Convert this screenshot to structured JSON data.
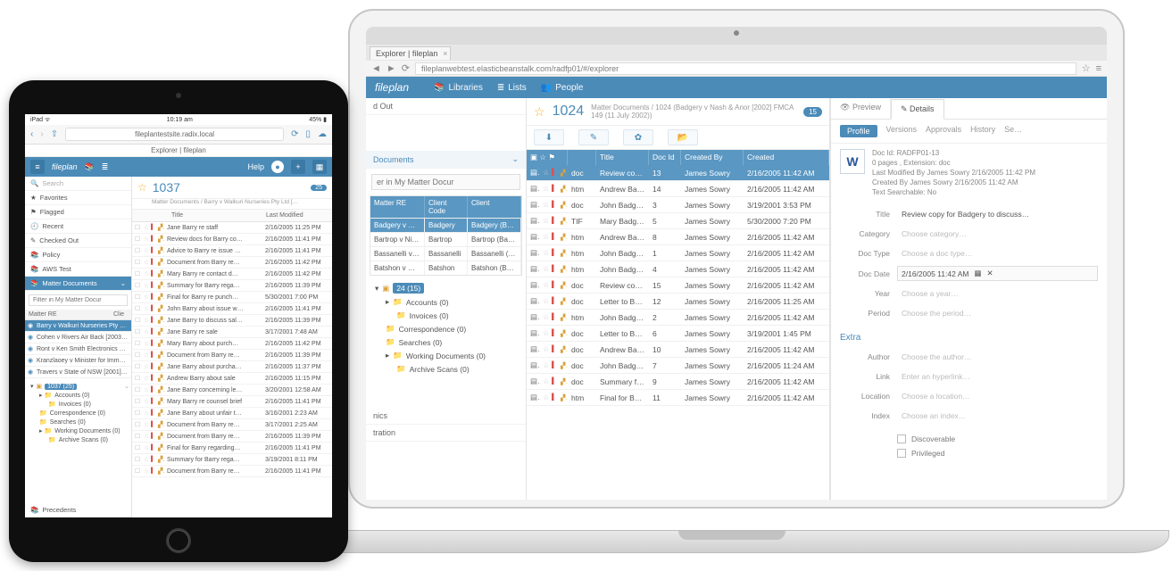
{
  "laptop": {
    "browser": {
      "tab_title": "Explorer | fileplan",
      "url": "fileplanwebtest.elasticbeanstalk.com/radfp01/#/explorer"
    },
    "appbar": {
      "brand": "fileplan",
      "items": [
        "Libraries",
        "Lists",
        "People"
      ]
    },
    "sidebar": {
      "checked_out": "d Out",
      "matter_docs": "Documents",
      "filter_ph": "er in My Matter Docur",
      "mini_head": [
        "Matter RE",
        "Client Code",
        "Client"
      ],
      "mini_rows": [
        [
          "Badgery v Nash & A…",
          "Badgery",
          "Badgery (Badgery…"
        ],
        [
          "Bartrop v Nilant & A…",
          "Bartrop",
          "Bartrop (Bartrop)"
        ],
        [
          "Bassanelli v QBE Ins…",
          "Bassanelli",
          "Bassanelli (Bassan…"
        ],
        [
          "Batshon v Miglioris…",
          "Batshon",
          "Batshon (Batshon…"
        ]
      ],
      "tree": {
        "root": "24 (15)",
        "n1": "Accounts (0)",
        "n1a": "Invoices (0)",
        "n2": "Correspondence (0)",
        "n3": "Searches (0)",
        "n4": "Working Documents (0)",
        "n4a": "Archive Scans (0)"
      },
      "foot1": "nics",
      "foot2": "tration"
    },
    "doclist": {
      "star": "☆",
      "matter_id": "1024",
      "crumb": "Matter Documents / 1024 (Badgery v Nash & Anor [2002] FMCA 149 (11 July 2002))",
      "badge": "15",
      "cols": [
        "Title",
        "Doc Id",
        "Created By",
        "Created"
      ],
      "rows": [
        {
          "type": "doc",
          "title": "Review copy for Ba…",
          "id": "13",
          "by": "James Sowry",
          "date": "2/16/2005 11:42 AM",
          "sel": true
        },
        {
          "type": "htm",
          "title": "Andrew Badgery ab…",
          "id": "14",
          "by": "James Sowry",
          "date": "2/16/2005 11:42 AM"
        },
        {
          "type": "doc",
          "title": "John Badgery to dis…",
          "id": "3",
          "by": "James Sowry",
          "date": "3/19/2001 3:53 PM"
        },
        {
          "type": "TIF",
          "title": "Mary Badgery re sale",
          "id": "5",
          "by": "James Sowry",
          "date": "5/30/2000 7:20 PM"
        },
        {
          "type": "htm",
          "title": "Andrew Badgery re…",
          "id": "8",
          "by": "James Sowry",
          "date": "2/16/2005 11:42 AM"
        },
        {
          "type": "htm",
          "title": "John Badgery regar…",
          "id": "1",
          "by": "James Sowry",
          "date": "2/16/2005 11:42 AM"
        },
        {
          "type": "htm",
          "title": "John Badgery re…",
          "id": "4",
          "by": "James Sowry",
          "date": "2/16/2005 11:42 AM"
        },
        {
          "type": "doc",
          "title": "Review copy for Ba…",
          "id": "15",
          "by": "James Sowry",
          "date": "2/16/2005 11:42 AM"
        },
        {
          "type": "doc",
          "title": "Letter to Badgery c…",
          "id": "12",
          "by": "James Sowry",
          "date": "2/16/2005 11:25 AM"
        },
        {
          "type": "htm",
          "title": "John Badgery regar…",
          "id": "2",
          "by": "James Sowry",
          "date": "2/16/2005 11:42 AM"
        },
        {
          "type": "doc",
          "title": "Letter to Badgery a…",
          "id": "6",
          "by": "James Sowry",
          "date": "3/19/2001 1:45 PM"
        },
        {
          "type": "doc",
          "title": "Andrew Badgery co…",
          "id": "10",
          "by": "James Sowry",
          "date": "2/16/2005 11:42 AM"
        },
        {
          "type": "doc",
          "title": "John Badgery to dis…",
          "id": "7",
          "by": "James Sowry",
          "date": "2/16/2005 11:24 AM"
        },
        {
          "type": "doc",
          "title": "Summary for Badge…",
          "id": "9",
          "by": "James Sowry",
          "date": "2/16/2005 11:42 AM"
        },
        {
          "type": "htm",
          "title": "Final for Badgery re…",
          "id": "11",
          "by": "James Sowry",
          "date": "2/16/2005 11:42 AM"
        }
      ]
    },
    "details": {
      "tabs": [
        "Preview",
        "Details"
      ],
      "subtabs": [
        "Profile",
        "Versions",
        "Approvals",
        "History",
        "Se…"
      ],
      "doc_id_label": "Doc Id:",
      "doc_id": "RADFP01-13",
      "pages": "0 pages , Extension: doc",
      "last_mod": "Last Modified By James Sowry 2/16/2005 11:42 PM",
      "created": "Created By James Sowry 2/16/2005 11:42 AM",
      "searchable": "Text Searchable:   No",
      "fields": {
        "title": {
          "label": "Title",
          "val": "Review copy for Badgery to discuss…"
        },
        "category": {
          "label": "Category",
          "ph": "Choose category…"
        },
        "doctype": {
          "label": "Doc Type",
          "ph": "Choose a doc type…"
        },
        "docdate": {
          "label": "Doc Date",
          "val": "2/16/2005 11:42 AM"
        },
        "year": {
          "label": "Year",
          "ph": "Choose a year…"
        },
        "period": {
          "label": "Period",
          "ph": "Choose the period…"
        }
      },
      "extra": "Extra",
      "extra_fields": {
        "author": {
          "label": "Author",
          "ph": "Choose the author…"
        },
        "link": {
          "label": "Link",
          "ph": "Enter an hyperlink…"
        },
        "location": {
          "label": "Location",
          "ph": "Choose a location…"
        },
        "index": {
          "label": "Index",
          "ph": "Choose an index…"
        }
      },
      "discoverable": "Discoverable",
      "privileged": "Privileged"
    }
  },
  "tablet": {
    "status": {
      "left": "iPad ᯤ",
      "time": "10:19 am",
      "right": "45% ▮"
    },
    "nav_url": "fileplantestsite.radix.local",
    "crumb": "Explorer | fileplan",
    "appbar": {
      "brand": "fileplan",
      "help": "Help"
    },
    "sidebar": {
      "search_ph": "Search",
      "items": [
        "Favorites",
        "Flagged",
        "Recent",
        "Checked Out",
        "Policy",
        "AWS Test"
      ],
      "matter_docs": "Matter Documents",
      "filter_ph": "Filter in My Matter Docur",
      "head": [
        "Matter RE",
        "Clie"
      ],
      "rows": [
        {
          "t": "Barry v Walkuri Nurseries Pty L…",
          "sel": true
        },
        {
          "t": "Cohen v Rivers Air Back [2003] …"
        },
        {
          "t": "Ront v Ken Smith Electronics P…"
        },
        {
          "t": "Kranzlaoey v Minister for Imm…"
        },
        {
          "t": "Travers v State of NSW [2001] F…"
        }
      ],
      "tree": {
        "root": "1037 (25)",
        "n1": "Accounts (0)",
        "n1a": "Invoices (0)",
        "n2": "Correspondence (0)",
        "n3": "Searches (0)",
        "n4": "Working Documents (0)",
        "n4a": "Archive Scans (0)"
      },
      "precedents": "Precedents"
    },
    "doclist": {
      "matter_id": "1037",
      "crumb": "Matter Documents / Barry v Walkuri Nurseries Pty Ltd […",
      "badge": "25",
      "cols": [
        "Title",
        "Last Modified"
      ],
      "rows": [
        {
          "t": "Jane Barry re staff",
          "d": "2/16/2005 11:25 PM"
        },
        {
          "t": "Review docs for Barry co…",
          "d": "2/16/2005 11:41 PM"
        },
        {
          "t": "Advice to Barry re issue …",
          "d": "2/16/2005 11:41 PM"
        },
        {
          "t": "Document from Barry re…",
          "d": "2/16/2005 11:42 PM"
        },
        {
          "t": "Mary Barry re contact d…",
          "d": "2/16/2005 11:42 PM"
        },
        {
          "t": "Summary for Barry rega…",
          "d": "2/16/2005 11:39 PM"
        },
        {
          "t": "Final for Barry re punch…",
          "d": "5/30/2001 7:00 PM"
        },
        {
          "t": "John Barry about issue w…",
          "d": "2/16/2005 11:41 PM"
        },
        {
          "t": "Jane Barry to discuss sal…",
          "d": "2/16/2005 11:39 PM"
        },
        {
          "t": "Jane Barry re sale",
          "d": "3/17/2001 7:48 AM"
        },
        {
          "t": "Mary Barry about purch…",
          "d": "2/16/2005 11:42 PM"
        },
        {
          "t": "Document from Barry re…",
          "d": "2/16/2005 11:39 PM"
        },
        {
          "t": "Jane Barry about purcha…",
          "d": "2/16/2005 11:37 PM"
        },
        {
          "t": "Andrew Barry about sale",
          "d": "2/16/2005 11:15 PM"
        },
        {
          "t": "Jane Barry concerning le…",
          "d": "3/20/2001 12:58 AM"
        },
        {
          "t": "Mary Barry re counsel brief",
          "d": "2/16/2005 11:41 PM"
        },
        {
          "t": "Jane Barry about unfair t…",
          "d": "3/16/2001 2:23 AM"
        },
        {
          "t": "Document from Barry re…",
          "d": "3/17/2001 2:25 AM"
        },
        {
          "t": "Document from Barry re…",
          "d": "2/16/2005 11:39 PM"
        },
        {
          "t": "Final for Barry regarding…",
          "d": "2/16/2005 11:41 PM"
        },
        {
          "t": "Summary for Barry rega…",
          "d": "3/19/2001 8:11 PM"
        },
        {
          "t": "Document from Barry re…",
          "d": "2/16/2005 11:41 PM"
        }
      ]
    }
  }
}
